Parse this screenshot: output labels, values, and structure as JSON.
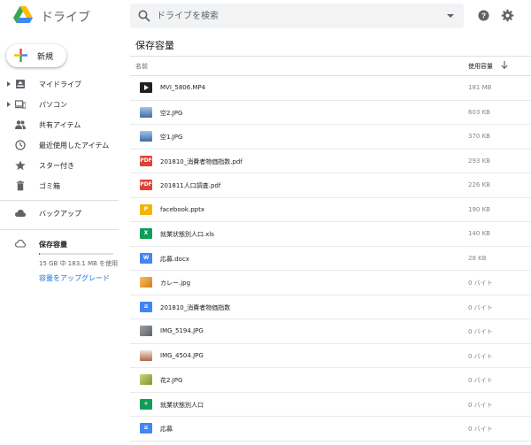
{
  "header": {
    "title": "ドライブ",
    "search_placeholder": "ドライブを検索"
  },
  "sidebar": {
    "new_label": "新規",
    "items": [
      {
        "label": "マイドライブ",
        "icon": "my-drive-icon",
        "expandable": true
      },
      {
        "label": "パソコン",
        "icon": "computers-icon",
        "expandable": true
      },
      {
        "label": "共有アイテム",
        "icon": "shared-icon",
        "expandable": false
      },
      {
        "label": "最近使用したアイテム",
        "icon": "recent-icon",
        "expandable": false
      },
      {
        "label": "スター付き",
        "icon": "star-icon",
        "expandable": false
      },
      {
        "label": "ゴミ箱",
        "icon": "trash-icon",
        "expandable": false
      }
    ],
    "backup_label": "バックアップ",
    "storage": {
      "title": "保存容量",
      "usage_text": "15 GB 中 183.1 MB を使用",
      "upgrade_label": "容量をアップグレード",
      "fill_fraction": 0.012
    }
  },
  "main": {
    "title": "保存容量",
    "columns": {
      "name": "名前",
      "size": "使用容量"
    },
    "files": [
      {
        "name": "MVI_5806.MP4",
        "size": "181 MB",
        "icon": "video-icon"
      },
      {
        "name": "空2.JPG",
        "size": "603 KB",
        "icon": "image-icon"
      },
      {
        "name": "空1.JPG",
        "size": "370 KB",
        "icon": "image-icon"
      },
      {
        "name": "201810_消費者物価指数.pdf",
        "size": "293 KB",
        "icon": "pdf-icon"
      },
      {
        "name": "201811人口調査.pdf",
        "size": "226 KB",
        "icon": "pdf-icon"
      },
      {
        "name": "facebook.pptx",
        "size": "190 KB",
        "icon": "pptx-icon"
      },
      {
        "name": "就業状態別人口.xls",
        "size": "140 KB",
        "icon": "xls-icon"
      },
      {
        "name": "応募.docx",
        "size": "28 KB",
        "icon": "docx-icon"
      },
      {
        "name": "カレー.jpg",
        "size": "0 バイト",
        "icon": "image-icon"
      },
      {
        "name": "201810_消費者物価指数",
        "size": "0 バイト",
        "icon": "google-docs-icon"
      },
      {
        "name": "IMG_5194.JPG",
        "size": "0 バイト",
        "icon": "image-icon"
      },
      {
        "name": "IMG_4504.JPG",
        "size": "0 バイト",
        "icon": "image-icon"
      },
      {
        "name": "花2.JPG",
        "size": "0 バイト",
        "icon": "image-icon"
      },
      {
        "name": "就業状態別人口",
        "size": "0 バイト",
        "icon": "google-sheets-icon"
      },
      {
        "name": "応募",
        "size": "0 バイト",
        "icon": "google-docs-icon"
      }
    ]
  },
  "colors": {
    "accent": "#1a73e8",
    "pdf": "#db4437",
    "sheets": "#0f9d58",
    "docs": "#4285f4",
    "slides": "#f4b400"
  }
}
